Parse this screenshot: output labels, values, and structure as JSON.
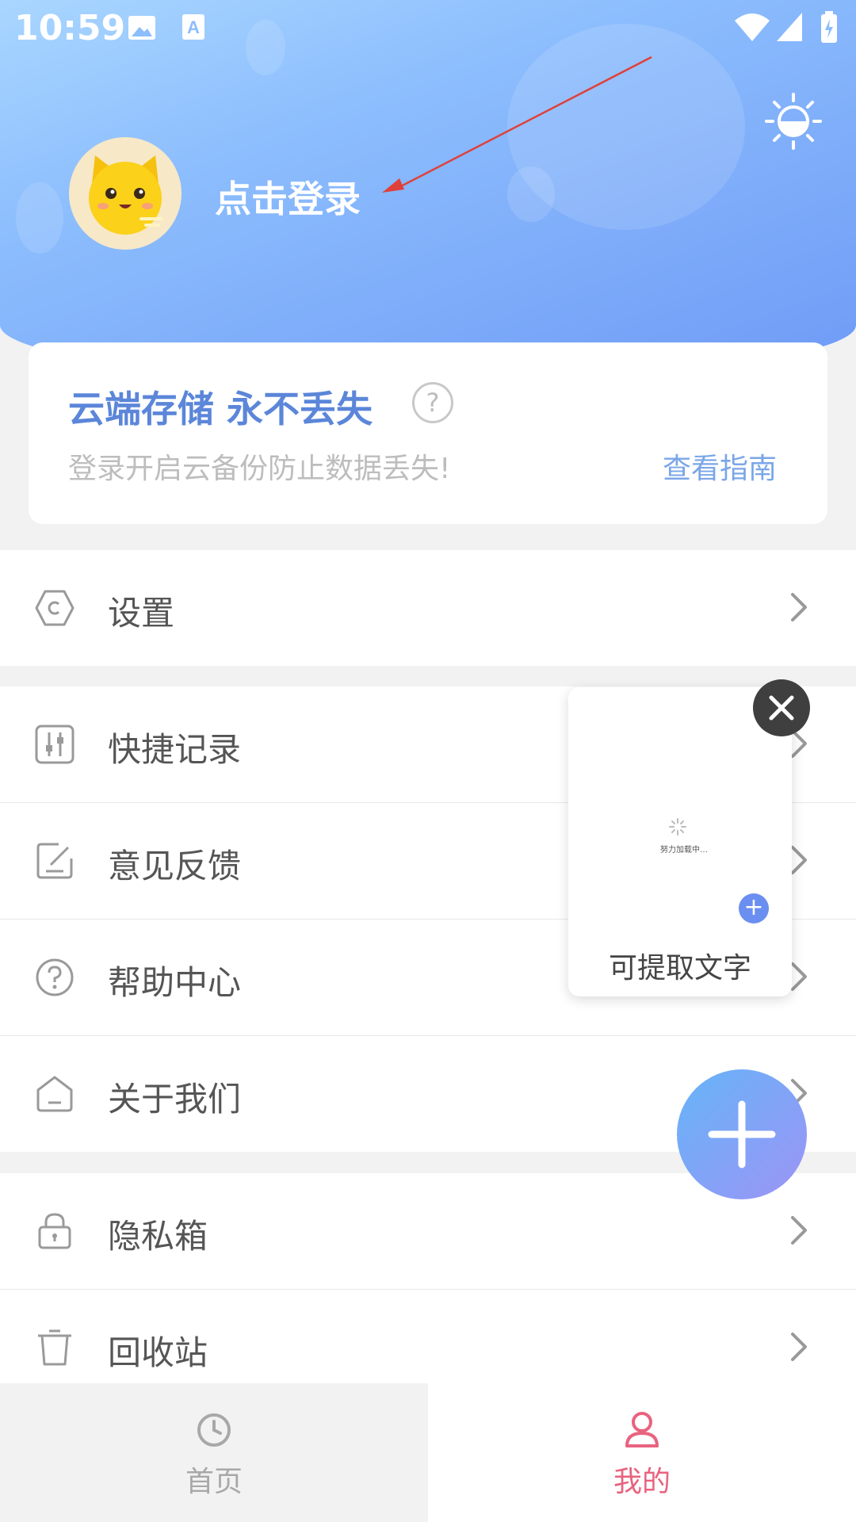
{
  "status_bar": {
    "time": "10:59"
  },
  "profile": {
    "login_text": "点击登录"
  },
  "cloud_card": {
    "title": "云端存储 永不丢失",
    "help_icon": "?",
    "subtitle": "登录开启云备份防止数据丢失!",
    "guide_link": "查看指南"
  },
  "menu": {
    "settings": "设置",
    "quick_record": "快捷记录",
    "feedback": "意见反馈",
    "help_center": "帮助中心",
    "about_us": "关于我们",
    "privacy_box": "隐私箱",
    "recycle_bin": "回收站"
  },
  "popup": {
    "loading_text": "努力加载中…",
    "plus": "+",
    "label": "可提取文字"
  },
  "nav": {
    "home": "首页",
    "mine": "我的"
  },
  "colors": {
    "accent_blue": "#5b86d9",
    "active_tab": "#e8637f",
    "inactive_tab": "#a8a8a8"
  }
}
